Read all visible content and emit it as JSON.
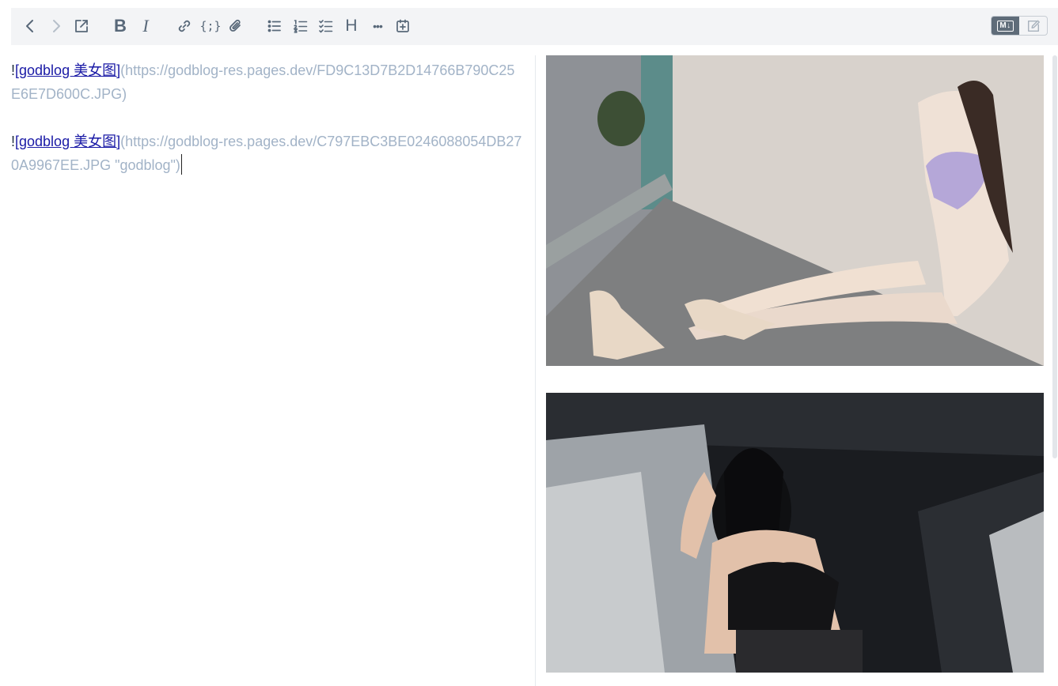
{
  "toolbar": {
    "buttons": [
      {
        "name": "back-icon",
        "state": "enabled"
      },
      {
        "name": "forward-icon",
        "state": "disabled"
      },
      {
        "name": "external-link-icon",
        "state": "enabled"
      },
      {
        "name": "bold-icon",
        "label": "B"
      },
      {
        "name": "italic-icon",
        "label": "I"
      },
      {
        "name": "link-icon"
      },
      {
        "name": "code-block-icon",
        "label": "{;}"
      },
      {
        "name": "attachment-icon"
      },
      {
        "name": "bullet-list-icon"
      },
      {
        "name": "numbered-list-icon"
      },
      {
        "name": "checklist-icon"
      },
      {
        "name": "heading-icon",
        "label": "H"
      },
      {
        "name": "more-icon",
        "label": "•••"
      },
      {
        "name": "insert-date-icon"
      }
    ],
    "mode_toggle": {
      "markdown_label": "M↓",
      "active": "markdown"
    }
  },
  "editor": {
    "images": [
      {
        "bang": "!",
        "alt_text": "[godblog 美女图]",
        "url_text": "(https://godblog-res.pages.dev/FD9C13D7B2D14766B790C25E6E7D600C.JPG)"
      },
      {
        "bang": "!",
        "alt_text": "[godblog 美女图]",
        "url_text": "(https://godblog-res.pages.dev/C797EBC3BE0246088054DB270A9967EE.JPG \"godblog\")"
      }
    ]
  },
  "colors": {
    "toolbar_bg": "#f3f4f6",
    "icon": "#586879",
    "url_text": "#a2b3c7",
    "link_text": "#1a1aa6"
  }
}
